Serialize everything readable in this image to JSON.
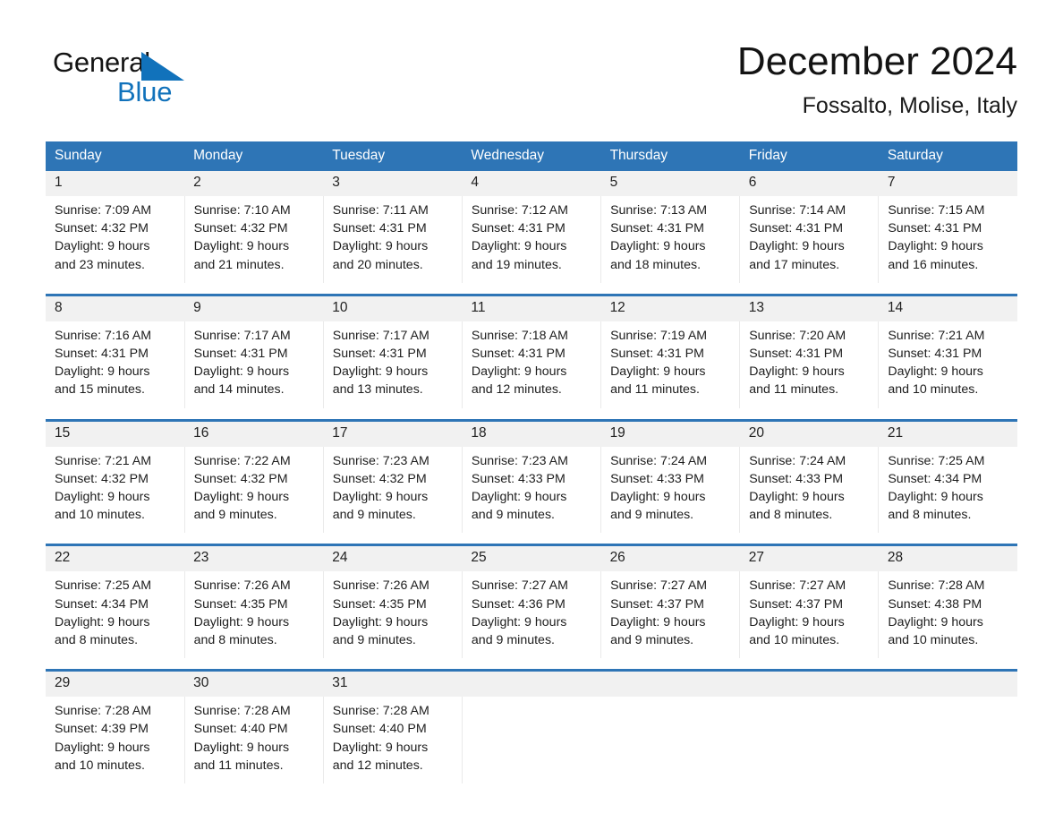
{
  "brand": {
    "line1": "General",
    "line2": "Blue",
    "triangle_color": "#1172bb",
    "line1_color": "#141414",
    "line2_color": "#1172bb",
    "triangle_icon": "triangle-icon"
  },
  "header": {
    "title": "December 2024",
    "subtitle": "Fossalto, Molise, Italy"
  },
  "theme": {
    "header_bg": "#2e75b6",
    "header_text": "#ffffff",
    "daynum_bg": "#f1f1f1",
    "cell_bg": "#ffffff",
    "separator": "#2e75b6"
  },
  "weekdays": [
    "Sunday",
    "Monday",
    "Tuesday",
    "Wednesday",
    "Thursday",
    "Friday",
    "Saturday"
  ],
  "weeks": [
    [
      {
        "day": "1",
        "sunrise": "Sunrise: 7:09 AM",
        "sunset": "Sunset: 4:32 PM",
        "daylight1": "Daylight: 9 hours",
        "daylight2": "and 23 minutes."
      },
      {
        "day": "2",
        "sunrise": "Sunrise: 7:10 AM",
        "sunset": "Sunset: 4:32 PM",
        "daylight1": "Daylight: 9 hours",
        "daylight2": "and 21 minutes."
      },
      {
        "day": "3",
        "sunrise": "Sunrise: 7:11 AM",
        "sunset": "Sunset: 4:31 PM",
        "daylight1": "Daylight: 9 hours",
        "daylight2": "and 20 minutes."
      },
      {
        "day": "4",
        "sunrise": "Sunrise: 7:12 AM",
        "sunset": "Sunset: 4:31 PM",
        "daylight1": "Daylight: 9 hours",
        "daylight2": "and 19 minutes."
      },
      {
        "day": "5",
        "sunrise": "Sunrise: 7:13 AM",
        "sunset": "Sunset: 4:31 PM",
        "daylight1": "Daylight: 9 hours",
        "daylight2": "and 18 minutes."
      },
      {
        "day": "6",
        "sunrise": "Sunrise: 7:14 AM",
        "sunset": "Sunset: 4:31 PM",
        "daylight1": "Daylight: 9 hours",
        "daylight2": "and 17 minutes."
      },
      {
        "day": "7",
        "sunrise": "Sunrise: 7:15 AM",
        "sunset": "Sunset: 4:31 PM",
        "daylight1": "Daylight: 9 hours",
        "daylight2": "and 16 minutes."
      }
    ],
    [
      {
        "day": "8",
        "sunrise": "Sunrise: 7:16 AM",
        "sunset": "Sunset: 4:31 PM",
        "daylight1": "Daylight: 9 hours",
        "daylight2": "and 15 minutes."
      },
      {
        "day": "9",
        "sunrise": "Sunrise: 7:17 AM",
        "sunset": "Sunset: 4:31 PM",
        "daylight1": "Daylight: 9 hours",
        "daylight2": "and 14 minutes."
      },
      {
        "day": "10",
        "sunrise": "Sunrise: 7:17 AM",
        "sunset": "Sunset: 4:31 PM",
        "daylight1": "Daylight: 9 hours",
        "daylight2": "and 13 minutes."
      },
      {
        "day": "11",
        "sunrise": "Sunrise: 7:18 AM",
        "sunset": "Sunset: 4:31 PM",
        "daylight1": "Daylight: 9 hours",
        "daylight2": "and 12 minutes."
      },
      {
        "day": "12",
        "sunrise": "Sunrise: 7:19 AM",
        "sunset": "Sunset: 4:31 PM",
        "daylight1": "Daylight: 9 hours",
        "daylight2": "and 11 minutes."
      },
      {
        "day": "13",
        "sunrise": "Sunrise: 7:20 AM",
        "sunset": "Sunset: 4:31 PM",
        "daylight1": "Daylight: 9 hours",
        "daylight2": "and 11 minutes."
      },
      {
        "day": "14",
        "sunrise": "Sunrise: 7:21 AM",
        "sunset": "Sunset: 4:31 PM",
        "daylight1": "Daylight: 9 hours",
        "daylight2": "and 10 minutes."
      }
    ],
    [
      {
        "day": "15",
        "sunrise": "Sunrise: 7:21 AM",
        "sunset": "Sunset: 4:32 PM",
        "daylight1": "Daylight: 9 hours",
        "daylight2": "and 10 minutes."
      },
      {
        "day": "16",
        "sunrise": "Sunrise: 7:22 AM",
        "sunset": "Sunset: 4:32 PM",
        "daylight1": "Daylight: 9 hours",
        "daylight2": "and 9 minutes."
      },
      {
        "day": "17",
        "sunrise": "Sunrise: 7:23 AM",
        "sunset": "Sunset: 4:32 PM",
        "daylight1": "Daylight: 9 hours",
        "daylight2": "and 9 minutes."
      },
      {
        "day": "18",
        "sunrise": "Sunrise: 7:23 AM",
        "sunset": "Sunset: 4:33 PM",
        "daylight1": "Daylight: 9 hours",
        "daylight2": "and 9 minutes."
      },
      {
        "day": "19",
        "sunrise": "Sunrise: 7:24 AM",
        "sunset": "Sunset: 4:33 PM",
        "daylight1": "Daylight: 9 hours",
        "daylight2": "and 9 minutes."
      },
      {
        "day": "20",
        "sunrise": "Sunrise: 7:24 AM",
        "sunset": "Sunset: 4:33 PM",
        "daylight1": "Daylight: 9 hours",
        "daylight2": "and 8 minutes."
      },
      {
        "day": "21",
        "sunrise": "Sunrise: 7:25 AM",
        "sunset": "Sunset: 4:34 PM",
        "daylight1": "Daylight: 9 hours",
        "daylight2": "and 8 minutes."
      }
    ],
    [
      {
        "day": "22",
        "sunrise": "Sunrise: 7:25 AM",
        "sunset": "Sunset: 4:34 PM",
        "daylight1": "Daylight: 9 hours",
        "daylight2": "and 8 minutes."
      },
      {
        "day": "23",
        "sunrise": "Sunrise: 7:26 AM",
        "sunset": "Sunset: 4:35 PM",
        "daylight1": "Daylight: 9 hours",
        "daylight2": "and 8 minutes."
      },
      {
        "day": "24",
        "sunrise": "Sunrise: 7:26 AM",
        "sunset": "Sunset: 4:35 PM",
        "daylight1": "Daylight: 9 hours",
        "daylight2": "and 9 minutes."
      },
      {
        "day": "25",
        "sunrise": "Sunrise: 7:27 AM",
        "sunset": "Sunset: 4:36 PM",
        "daylight1": "Daylight: 9 hours",
        "daylight2": "and 9 minutes."
      },
      {
        "day": "26",
        "sunrise": "Sunrise: 7:27 AM",
        "sunset": "Sunset: 4:37 PM",
        "daylight1": "Daylight: 9 hours",
        "daylight2": "and 9 minutes."
      },
      {
        "day": "27",
        "sunrise": "Sunrise: 7:27 AM",
        "sunset": "Sunset: 4:37 PM",
        "daylight1": "Daylight: 9 hours",
        "daylight2": "and 10 minutes."
      },
      {
        "day": "28",
        "sunrise": "Sunrise: 7:28 AM",
        "sunset": "Sunset: 4:38 PM",
        "daylight1": "Daylight: 9 hours",
        "daylight2": "and 10 minutes."
      }
    ],
    [
      {
        "day": "29",
        "sunrise": "Sunrise: 7:28 AM",
        "sunset": "Sunset: 4:39 PM",
        "daylight1": "Daylight: 9 hours",
        "daylight2": "and 10 minutes."
      },
      {
        "day": "30",
        "sunrise": "Sunrise: 7:28 AM",
        "sunset": "Sunset: 4:40 PM",
        "daylight1": "Daylight: 9 hours",
        "daylight2": "and 11 minutes."
      },
      {
        "day": "31",
        "sunrise": "Sunrise: 7:28 AM",
        "sunset": "Sunset: 4:40 PM",
        "daylight1": "Daylight: 9 hours",
        "daylight2": "and 12 minutes."
      },
      {
        "day": "",
        "sunrise": "",
        "sunset": "",
        "daylight1": "",
        "daylight2": ""
      },
      {
        "day": "",
        "sunrise": "",
        "sunset": "",
        "daylight1": "",
        "daylight2": ""
      },
      {
        "day": "",
        "sunrise": "",
        "sunset": "",
        "daylight1": "",
        "daylight2": ""
      },
      {
        "day": "",
        "sunrise": "",
        "sunset": "",
        "daylight1": "",
        "daylight2": ""
      }
    ]
  ]
}
